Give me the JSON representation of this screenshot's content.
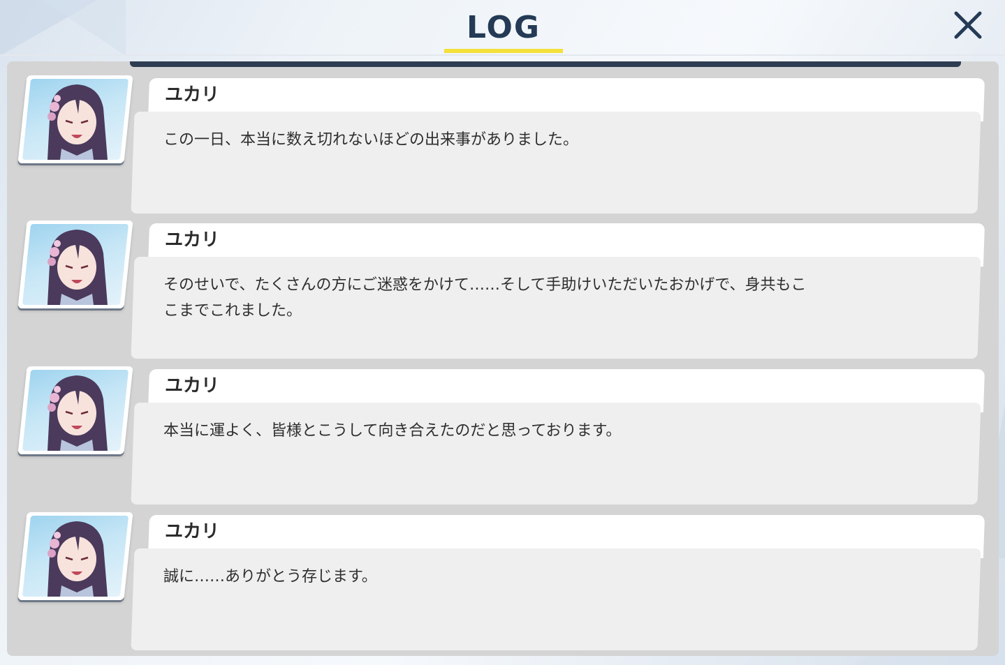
{
  "header": {
    "title": "LOG",
    "accent_color": "#f4e03a",
    "close_icon": "close-icon"
  },
  "log": {
    "entries": [
      {
        "speaker": "ユカリ",
        "text": "この一日、本当に数え切れないほどの出来事がありました。",
        "avatar_icon": "character-portrait-icon"
      },
      {
        "speaker": "ユカリ",
        "text": "そのせいで、たくさんの方にご迷惑をかけて……そして手助けいただいたおかげで、身共もこ\nこまでこれました。",
        "avatar_icon": "character-portrait-icon"
      },
      {
        "speaker": "ユカリ",
        "text": "本当に運よく、皆様とこうして向き合えたのだと思っております。",
        "avatar_icon": "character-portrait-icon"
      },
      {
        "speaker": "ユカリ",
        "text": "誠に……ありがとう存じます。",
        "avatar_icon": "character-portrait-icon"
      }
    ]
  }
}
